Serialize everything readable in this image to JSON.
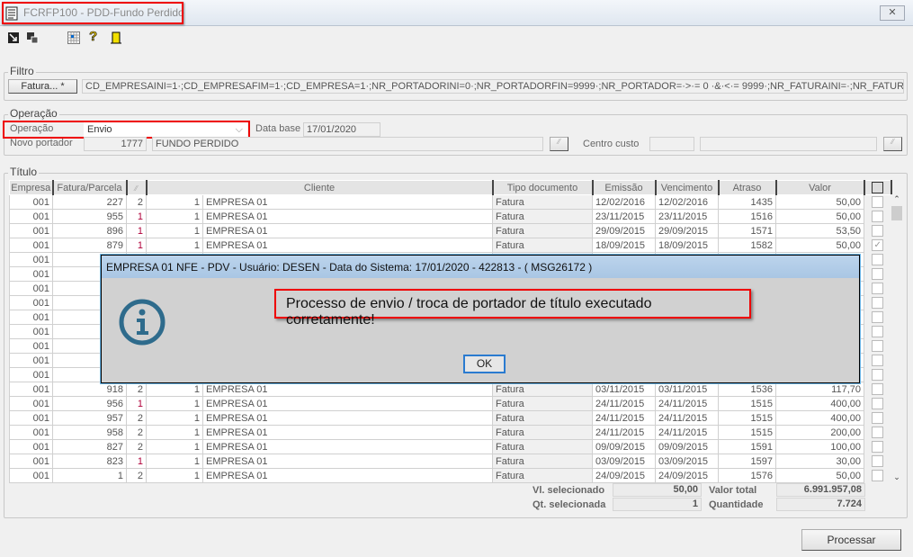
{
  "window": {
    "title": "FCRFP100 - PDD-Fundo Perdido",
    "close": "✕"
  },
  "toolbar": {
    "icons": [
      "export-icon",
      "copy-icon",
      "grid-icon",
      "help-icon",
      "exit-door-icon"
    ],
    "help": "?"
  },
  "filtro": {
    "label": "Filtro",
    "button": "Fatura... *",
    "value": "CD_EMPRESAINI=1·;CD_EMPRESAFIM=1·;CD_EMPRESA=1·;NR_PORTADORINI=0·;NR_PORTADORFIN=9999·;NR_PORTADOR=·>·= 0 ·&·<·= 9999·;NR_FATURAINI=·;NR_FATURAFIN=·;NR_FATURA"
  },
  "operacao": {
    "label": "Operação",
    "op_label": "Operação",
    "op_value": "Envio",
    "data_base_label": "Data base",
    "data_base": "17/01/2020",
    "novo_portador_label": "Novo portador",
    "portador_code": "1777",
    "portador_name": "FUNDO PERDIDO",
    "centro_custo_label": "Centro custo",
    "centro_custo_code": "",
    "centro_custo_name": ""
  },
  "titulo": {
    "label": "Título",
    "columns": [
      "Empresa",
      "Fatura/Parcela",
      "",
      "",
      "Cliente",
      "Tipo documento",
      "Emissão",
      "Vencimento",
      "Atraso",
      "Valor",
      ""
    ],
    "rows": [
      [
        "001",
        "227",
        "2",
        "1",
        "EMPRESA 01",
        "Fatura",
        "12/02/2016",
        "12/02/2016",
        "1435",
        "50,00",
        false
      ],
      [
        "001",
        "955",
        "1",
        "1",
        "EMPRESA 01",
        "Fatura",
        "23/11/2015",
        "23/11/2015",
        "1516",
        "50,00",
        false
      ],
      [
        "001",
        "896",
        "1",
        "1",
        "EMPRESA 01",
        "Fatura",
        "29/09/2015",
        "29/09/2015",
        "1571",
        "53,50",
        false
      ],
      [
        "001",
        "879",
        "1",
        "1",
        "EMPRESA 01",
        "Fatura",
        "18/09/2015",
        "18/09/2015",
        "1582",
        "50,00",
        true
      ],
      [
        "001",
        "",
        "",
        "",
        "",
        "",
        "",
        "",
        "",
        "",
        false
      ],
      [
        "001",
        "",
        "",
        "",
        "",
        "",
        "",
        "",
        "",
        "",
        false
      ],
      [
        "001",
        "",
        "",
        "",
        "",
        "",
        "",
        "",
        "",
        "",
        false
      ],
      [
        "001",
        "",
        "",
        "",
        "",
        "",
        "",
        "",
        "",
        "",
        false
      ],
      [
        "001",
        "",
        "",
        "",
        "",
        "",
        "",
        "",
        "",
        "",
        false
      ],
      [
        "001",
        "",
        "",
        "",
        "",
        "",
        "",
        "",
        "",
        "",
        false
      ],
      [
        "001",
        "",
        "",
        "",
        "",
        "",
        "",
        "",
        "",
        "",
        false
      ],
      [
        "001",
        "",
        "",
        "",
        "",
        "",
        "",
        "",
        "",
        "",
        false
      ],
      [
        "001",
        "",
        "",
        "",
        "",
        "",
        "",
        "",
        "",
        "",
        false
      ],
      [
        "001",
        "918",
        "2",
        "1",
        "EMPRESA 01",
        "Fatura",
        "03/11/2015",
        "03/11/2015",
        "1536",
        "117,70",
        false
      ],
      [
        "001",
        "956",
        "1",
        "1",
        "EMPRESA 01",
        "Fatura",
        "24/11/2015",
        "24/11/2015",
        "1515",
        "400,00",
        false
      ],
      [
        "001",
        "957",
        "2",
        "1",
        "EMPRESA 01",
        "Fatura",
        "24/11/2015",
        "24/11/2015",
        "1515",
        "400,00",
        false
      ],
      [
        "001",
        "958",
        "2",
        "1",
        "EMPRESA 01",
        "Fatura",
        "24/11/2015",
        "24/11/2015",
        "1515",
        "200,00",
        false
      ],
      [
        "001",
        "827",
        "2",
        "1",
        "EMPRESA 01",
        "Fatura",
        "09/09/2015",
        "09/09/2015",
        "1591",
        "100,00",
        false
      ],
      [
        "001",
        "823",
        "1",
        "1",
        "EMPRESA 01",
        "Fatura",
        "03/09/2015",
        "03/09/2015",
        "1597",
        "30,00",
        false
      ],
      [
        "001",
        "1",
        "2",
        "1",
        "EMPRESA 01",
        "Fatura",
        "24/09/2015",
        "24/09/2015",
        "1576",
        "50,00",
        false
      ]
    ]
  },
  "summary": {
    "vl_sel_label": "Vl. selecionado",
    "vl_sel": "50,00",
    "valor_total_label": "Valor total",
    "valor_total": "6.991.957,08",
    "qt_sel_label": "Qt. selecionada",
    "qt_sel": "1",
    "quantidade_label": "Quantidade",
    "quantidade": "7.724"
  },
  "processar": "Processar",
  "dialog": {
    "title": "EMPRESA 01 NFE - PDV - Usuário: DESEN - Data do Sistema: 17/01/2020 - 422813 - ( MSG26172 )",
    "message": "Processo de envio / troca de portador de título executado corretamente!",
    "ok": "OK",
    "icon": "info-icon"
  },
  "colors": {
    "highlight": "#ee0000",
    "info_icon": "#2e6b8c",
    "parcela_one": "#b0003a"
  }
}
